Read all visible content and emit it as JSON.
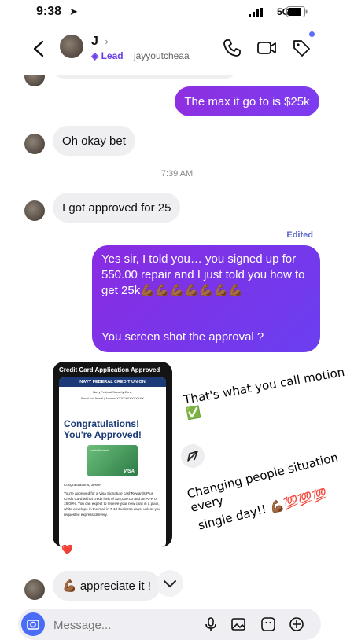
{
  "status": {
    "time": "9:38",
    "network": "5G"
  },
  "header": {
    "name": "J",
    "tag": "Lead",
    "handle": "jayyoutcheaa"
  },
  "messages": [
    {
      "from": "me",
      "text": "The max it go to is $25k"
    },
    {
      "from": "them",
      "text": "Oh okay bet"
    },
    {
      "from": "them",
      "text": "I got approved for 25"
    },
    {
      "from": "me",
      "text": "Yes sir, I told you… you signed up for 550.00 repair and I just told you how to get 25k💪🏾💪🏾💪🏾💪🏾💪🏾💪🏾💪🏾",
      "text2": "You screen shot the approval ?"
    },
    {
      "from": "them",
      "text": "💪🏾 appreciate it !"
    }
  ],
  "timestamp": "7:39 AM",
  "edited_label": "Edited",
  "screenshot": {
    "title": "Credit Card Application Approved",
    "bank": "NAVY FEDERAL CREDIT UNION",
    "zone": "Navy Federal Security Zone",
    "email_line": "Email for Jessel | Access XXXXXXXXXXXXX",
    "headline1": "Congratulations!",
    "headline2": "You're Approved!",
    "card_brand": "cashRewards",
    "card_network": "VISA",
    "greeting": "Congratulations, Jessel",
    "body": "You're approved for a Visa Signature cashRewards Plus Credit Card with a credit limit of $25,000.00 and an APR of 18.00%. You can expect to receive your new card in a plain, white envelope in the mail in 7-10 business days, unless you requested express delivery."
  },
  "captions": {
    "c1": "That's what you call motion ✅",
    "c2a": "Changing people situation every",
    "c2b": "single day!! 💪🏾💯💯💯"
  },
  "reaction": "❤️",
  "composer": {
    "placeholder": "Message..."
  },
  "colors": {
    "gradient_start": "#8a2be2",
    "gradient_end": "#6a3ff0",
    "accent": "#6a3ee6"
  }
}
